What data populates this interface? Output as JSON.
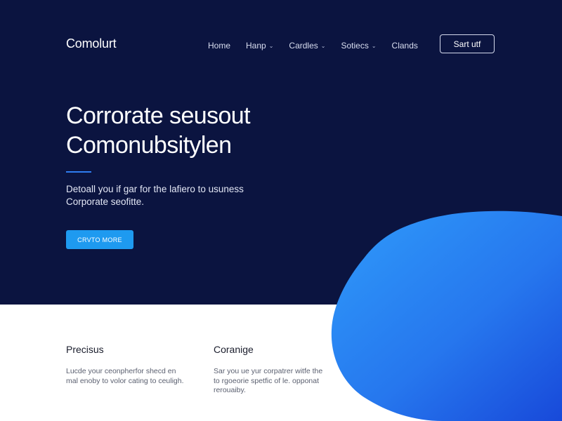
{
  "header": {
    "logo": "Comolurt",
    "nav": [
      {
        "label": "Home",
        "dropdown": false
      },
      {
        "label": "Hanp",
        "dropdown": true
      },
      {
        "label": "Cardles",
        "dropdown": true
      },
      {
        "label": "Sotiecs",
        "dropdown": true
      },
      {
        "label": "Clands",
        "dropdown": false
      }
    ],
    "cta_label": "Sart utf"
  },
  "hero": {
    "headline_line1": "Corrorate seusout",
    "headline_line2": "Comonubsitylen",
    "subtext_line1": "Detoall you if gar for the lafiero to usuness",
    "subtext_line2": "Corporate seofitte.",
    "button_label": "CRVTO MORE"
  },
  "features": [
    {
      "title": "Precisus",
      "line1": "Lucde your ceonpherfor shecd en",
      "line2": "mal enoby to volor cating to ceuligh."
    },
    {
      "title": "Coranige",
      "line1": "Sar you ue yur corpatrer witfe the",
      "line2": "to rgoeorie spetfic of le. opponat",
      "line3": "rerouaiby."
    }
  ],
  "colors": {
    "hero_bg": "#0b1440",
    "accent": "#2f7cf0",
    "button": "#1e9af0",
    "blob_light": "#2a8ff7",
    "blob_dark": "#1a56e0"
  },
  "icons": {
    "nav_dropdown": "chevron-down-icon"
  }
}
